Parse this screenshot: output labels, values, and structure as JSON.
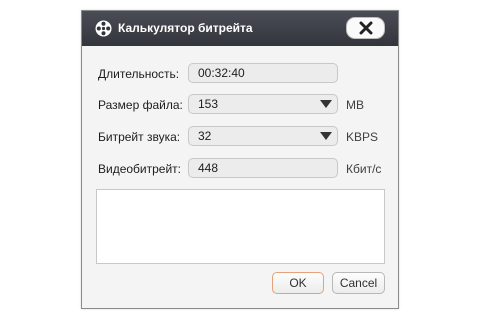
{
  "window": {
    "title": "Калькулятор битрейта",
    "icon": "film-reel-icon",
    "close_icon": "close-icon"
  },
  "fields": {
    "duration": {
      "label": "Длительность:",
      "value": "00:32:40"
    },
    "file_size": {
      "label": "Размер файла:",
      "value": "153",
      "unit": "MB"
    },
    "audio_bitrate": {
      "label": "Битрейт звука:",
      "value": "32",
      "unit": "KBPS"
    },
    "video_bitrate": {
      "label": "Видеобитрейт:",
      "value": "448",
      "unit": "Кбит/с"
    }
  },
  "buttons": {
    "ok": "OK",
    "cancel": "Cancel"
  },
  "colors": {
    "titlebar": "#3c3e45",
    "ok_border": "#e2a27c"
  }
}
